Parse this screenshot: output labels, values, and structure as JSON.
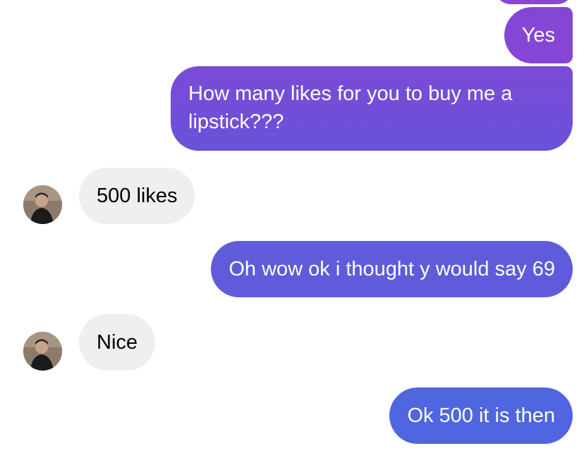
{
  "conversation": {
    "messages": [
      {
        "direction": "outgoing",
        "text": "Yes"
      },
      {
        "direction": "outgoing",
        "text_lines": [
          "How many likes for you to buy me a",
          "lipstick???"
        ]
      },
      {
        "direction": "incoming",
        "text": "500 likes",
        "avatar_icon": "contact-avatar"
      },
      {
        "direction": "outgoing",
        "text": "Oh wow ok i thought y would say 69"
      },
      {
        "direction": "incoming",
        "text": "Nice",
        "avatar_icon": "contact-avatar"
      },
      {
        "direction": "outgoing",
        "text": "Ok 500 it is then"
      }
    ]
  },
  "colors": {
    "outgoing_top": "#8a47d6",
    "outgoing_mid": "#6a55d9",
    "outgoing_bottom": "#4f66e0",
    "incoming_bubble": "#efefef",
    "background": "#ffffff"
  }
}
